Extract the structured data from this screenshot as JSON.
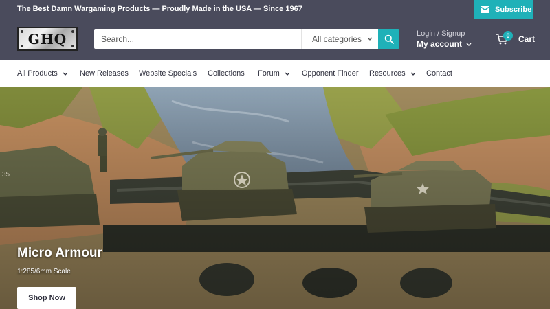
{
  "topbar": {
    "announcement": "The Best Damn Wargaming Products — Proudly Made in the USA — Since 1967",
    "subscribe_label": "Subscribe",
    "subscribe_icon": "mail-icon"
  },
  "header": {
    "logo_text": "GHQ",
    "search": {
      "placeholder": "Search...",
      "value": ""
    },
    "category_select": "All categories",
    "search_icon": "search-icon",
    "account": {
      "login_label": "Login / Signup",
      "my_account_label": "My account"
    },
    "cart": {
      "count": "0",
      "label": "Cart",
      "icon": "cart-icon"
    }
  },
  "nav": {
    "items": [
      {
        "label": "All Products",
        "dropdown": true
      },
      {
        "label": "New Releases",
        "dropdown": false
      },
      {
        "label": "Website Specials",
        "dropdown": false
      },
      {
        "label": "Collections",
        "dropdown": false
      },
      {
        "label": "Forum",
        "dropdown": true
      },
      {
        "label": "Opponent Finder",
        "dropdown": false
      },
      {
        "label": "Resources",
        "dropdown": true
      },
      {
        "label": "Contact",
        "dropdown": false
      }
    ]
  },
  "hero": {
    "title": "Micro Armour",
    "subtitle": "1:285/6mm Scale",
    "button_label": "Shop Now"
  },
  "colors": {
    "header_bg": "#4a4b5c",
    "accent": "#1fb1b8",
    "nav_text": "#2e2f3d",
    "white": "#ffffff"
  }
}
